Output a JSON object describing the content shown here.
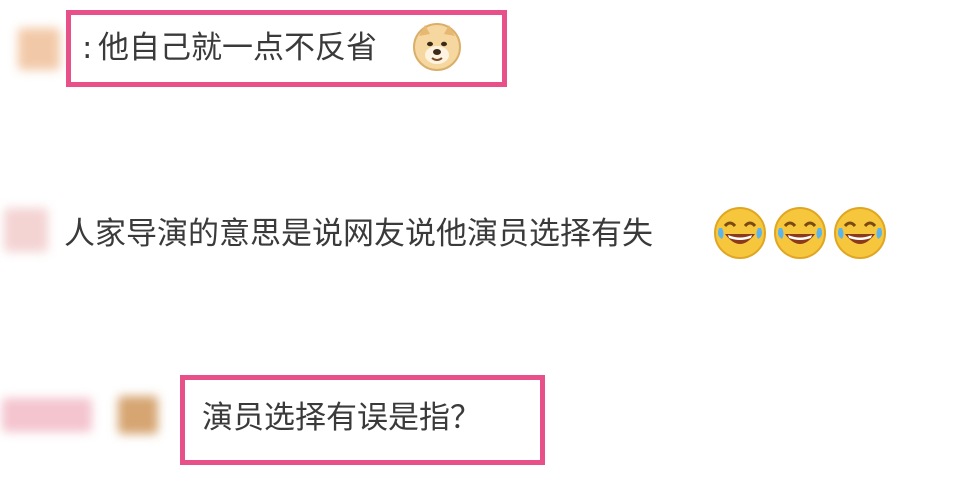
{
  "comments": [
    {
      "prefix": ":",
      "text": "他自己就一点不反省",
      "emojis": [
        "doge-icon"
      ],
      "highlighted": true
    },
    {
      "prefix": "",
      "text": "人家导演的意思是说网友说他演员选择有失",
      "emojis": [
        "laugh-cry-icon",
        "laugh-cry-icon",
        "laugh-cry-icon"
      ],
      "highlighted": false
    },
    {
      "prefix": "",
      "text": "演员选择有误是指？",
      "emojis": [],
      "highlighted": true
    }
  ],
  "colors": {
    "highlight": "#e8508a",
    "text": "#3a3a3a"
  }
}
